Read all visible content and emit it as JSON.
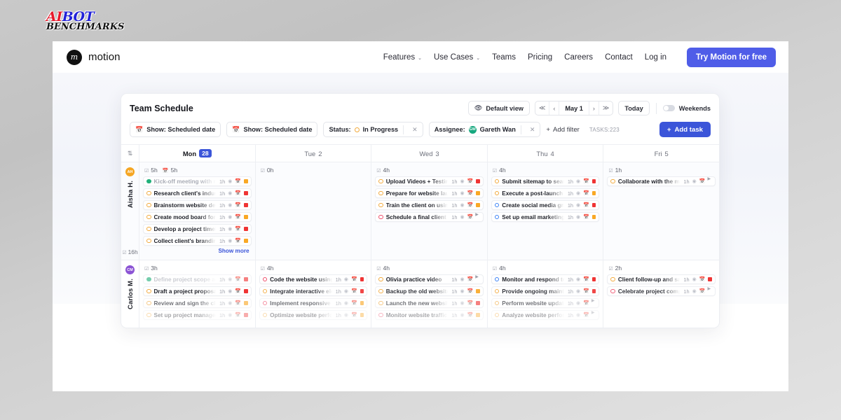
{
  "watermark": {
    "line1a": "AI",
    "line1b": "BOT",
    "line2": "BENCHMARKS"
  },
  "sitenav": {
    "brand_mark": "m",
    "brand_name": "motion",
    "links": [
      {
        "label": "Features",
        "caret": "⌄"
      },
      {
        "label": "Use Cases",
        "caret": "⌄"
      },
      {
        "label": "Teams",
        "caret": ""
      },
      {
        "label": "Pricing",
        "caret": ""
      },
      {
        "label": "Careers",
        "caret": ""
      },
      {
        "label": "Contact",
        "caret": ""
      },
      {
        "label": "Log in",
        "caret": ""
      }
    ],
    "cta_label": "Try Motion for free",
    "cta_color": "#4f5de8"
  },
  "schedule": {
    "title": "Team Schedule",
    "view_button": {
      "icon": "eye-icon",
      "label": "Default view"
    },
    "date_nav": {
      "first": "≪",
      "prev": "‹",
      "label": "May 1",
      "next": "›",
      "last": "≫"
    },
    "today_label": "Today",
    "weekends_label": "Weekends",
    "weekends_on": false,
    "filters": [
      {
        "kind": "date",
        "icon": "calendar-icon",
        "label": "Show: Scheduled date",
        "dismissible": false
      },
      {
        "kind": "date",
        "icon": "calendar-icon",
        "label": "Show: Scheduled date",
        "dismissible": false
      },
      {
        "kind": "status",
        "prefix": "Status:",
        "value": "In Progress",
        "dot": "#f2a93b",
        "dismissible": true
      },
      {
        "kind": "assignee",
        "prefix": "Assignee:",
        "value": "Gareth Wan",
        "avatar_initials": "GW",
        "avatar_color": "#17a87f",
        "dismissible": true
      }
    ],
    "add_filter_label": "Add filter",
    "task_count_label": "TASKS:223",
    "add_task_label": "Add task",
    "accent_color": "#3b55d9",
    "sort_icon": "sort-arrows-icon",
    "columns": [
      {
        "day": "Mon",
        "date": "28",
        "today": true
      },
      {
        "day": "Tue",
        "date": "2",
        "today": false
      },
      {
        "day": "Wed",
        "date": "3",
        "today": false
      },
      {
        "day": "Thu",
        "date": "4",
        "today": false
      },
      {
        "day": "Fri",
        "date": "5",
        "today": false
      }
    ],
    "rows": [
      {
        "person": {
          "initials": "AH",
          "name": "Aisha H.",
          "color": "#f5a623",
          "total": "16h"
        },
        "cells": [
          {
            "summary": "5h",
            "summary2": "5h",
            "show_more": "Show more",
            "tasks": [
              {
                "title": "Kick-off meeting with new c",
                "duration": "1h",
                "state": "done",
                "flag": "orange",
                "fade": ""
              },
              {
                "title": "Research client's industry a",
                "duration": "1h",
                "state": "open",
                "flag": "red",
                "fade": ""
              },
              {
                "title": "Brainstorm website design",
                "duration": "1h",
                "state": "open",
                "flag": "red",
                "fade": ""
              },
              {
                "title": "Create mood board for desig",
                "duration": "1h",
                "state": "open",
                "flag": "orange",
                "fade": ""
              },
              {
                "title": "Develop a project timeline",
                "duration": "1h",
                "state": "open",
                "flag": "red",
                "fade": ""
              },
              {
                "title": "Collect client's branding as",
                "duration": "1h",
                "state": "open",
                "flag": "orange",
                "fade": ""
              }
            ]
          },
          {
            "summary": "0h",
            "summary2": "",
            "show_more": "",
            "tasks": []
          },
          {
            "summary": "4h",
            "summary2": "",
            "show_more": "",
            "tasks": [
              {
                "title": "Upload Videos + Testimonia",
                "duration": "1h",
                "state": "orange",
                "flag": "red",
                "fade": ""
              },
              {
                "title": "Prepare for website launch",
                "duration": "1h",
                "state": "orange",
                "flag": "orange",
                "fade": ""
              },
              {
                "title": "Train the client on using the",
                "duration": "1h",
                "state": "orange",
                "flag": "orange",
                "fade": ""
              },
              {
                "title": "Schedule a final client revie",
                "duration": "1h",
                "state": "red",
                "flag": "gray",
                "fade": ""
              }
            ]
          },
          {
            "summary": "4h",
            "summary2": "",
            "show_more": "",
            "tasks": [
              {
                "title": "Submit sitemap to search en",
                "duration": "1h",
                "state": "orange",
                "flag": "red",
                "fade": ""
              },
              {
                "title": "Execute a post-launch mark",
                "duration": "1h",
                "state": "orange",
                "flag": "orange",
                "fade": ""
              },
              {
                "title": "Create social media graphic",
                "duration": "1h",
                "state": "blue",
                "flag": "red",
                "fade": ""
              },
              {
                "title": "Set up email marketing cam",
                "duration": "1h",
                "state": "blue",
                "flag": "orange",
                "fade": ""
              }
            ]
          },
          {
            "summary": "1h",
            "summary2": "",
            "show_more": "",
            "tasks": [
              {
                "title": "Collaborate with the market",
                "duration": "1h",
                "state": "orange",
                "flag": "gray",
                "fade": ""
              }
            ]
          }
        ]
      },
      {
        "person": {
          "initials": "CM",
          "name": "Carlos M.",
          "color": "#8b53d4",
          "total": ""
        },
        "cells": [
          {
            "summary": "3h",
            "summary2": "",
            "show_more": "",
            "tasks": [
              {
                "title": "Define project scope and",
                "duration": "1h",
                "state": "done",
                "flag": "red",
                "fade": "f7"
              },
              {
                "title": "Draft a project proposal",
                "duration": "1h",
                "state": "open",
                "flag": "red",
                "fade": ""
              },
              {
                "title": "Review and sign the client c",
                "duration": "1h",
                "state": "open",
                "flag": "orange",
                "fade": "f7"
              },
              {
                "title": "Set up project management",
                "duration": "1h",
                "state": "open",
                "flag": "red",
                "fade": "f5"
              }
            ]
          },
          {
            "summary": "4h",
            "summary2": "",
            "show_more": "",
            "tasks": [
              {
                "title": "Code the website using HTM",
                "duration": "1h",
                "state": "red",
                "flag": "red",
                "fade": ""
              },
              {
                "title": "Integrate interactive elemen",
                "duration": "1h",
                "state": "orange",
                "flag": "red",
                "fade": "f9"
              },
              {
                "title": "Implement responsive desig",
                "duration": "1h",
                "state": "red",
                "flag": "orange",
                "fade": "f7"
              },
              {
                "title": "Optimize website performan",
                "duration": "1h",
                "state": "orange",
                "flag": "orange",
                "fade": "f5"
              }
            ]
          },
          {
            "summary": "4h",
            "summary2": "",
            "show_more": "",
            "tasks": [
              {
                "title": "Olivia practice video",
                "duration": "1h",
                "state": "orange",
                "flag": "gray",
                "fade": ""
              },
              {
                "title": "Backup the old website",
                "duration": "1h",
                "state": "orange",
                "flag": "orange",
                "fade": "f9"
              },
              {
                "title": "Launch the new website",
                "duration": "1h",
                "state": "orange",
                "flag": "red",
                "fade": "f7"
              },
              {
                "title": "Monitor website traffic post",
                "duration": "1h",
                "state": "red",
                "flag": "orange",
                "fade": "f5"
              }
            ]
          },
          {
            "summary": "4h",
            "summary2": "",
            "show_more": "",
            "tasks": [
              {
                "title": "Monitor and respond to user",
                "duration": "1h",
                "state": "blue",
                "flag": "red",
                "fade": ""
              },
              {
                "title": "Provide ongoing maintenanc",
                "duration": "1h",
                "state": "orange",
                "flag": "red",
                "fade": "f9"
              },
              {
                "title": "Perform website updates an",
                "duration": "1h",
                "state": "orange",
                "flag": "gray",
                "fade": "f7"
              },
              {
                "title": "Analyze website performanc",
                "duration": "1h",
                "state": "orange",
                "flag": "gray",
                "fade": "f5"
              }
            ]
          },
          {
            "summary": "2h",
            "summary2": "",
            "show_more": "",
            "tasks": [
              {
                "title": "Client follow-up and satisfa",
                "duration": "1h",
                "state": "orange",
                "flag": "red",
                "fade": ""
              },
              {
                "title": "Celebrate project completio",
                "duration": "1h",
                "state": "red",
                "flag": "gray",
                "fade": "f9"
              }
            ]
          }
        ]
      }
    ]
  }
}
